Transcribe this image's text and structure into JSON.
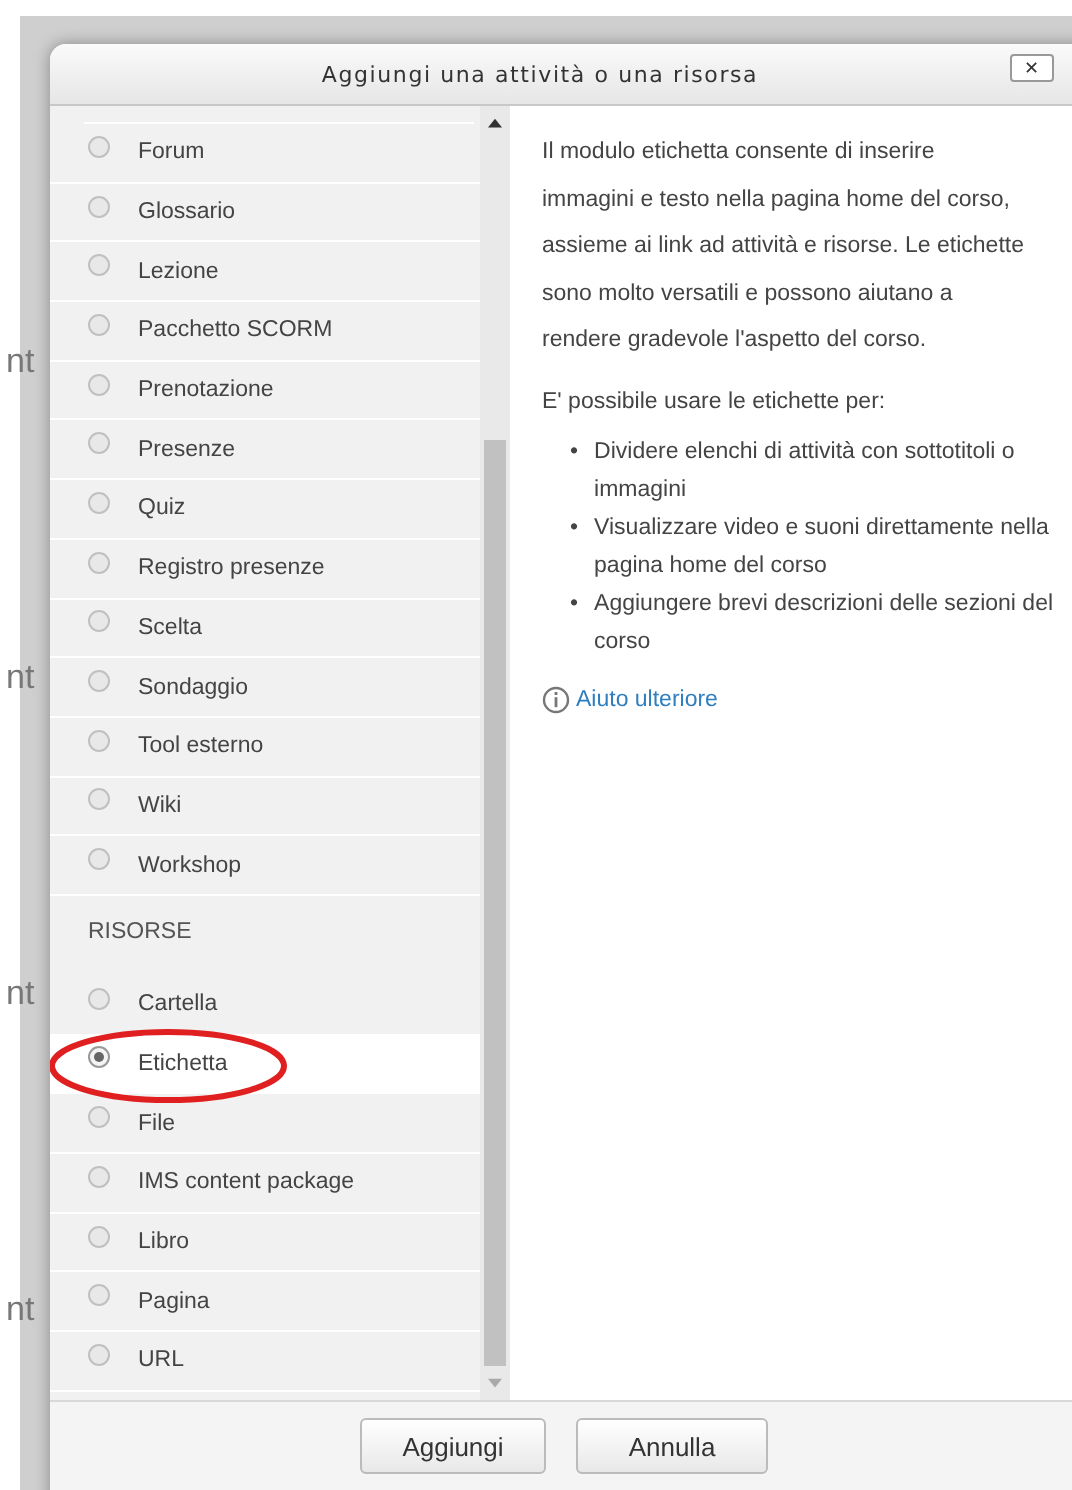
{
  "background": {
    "fragments": [
      "nt",
      "nt",
      "nt",
      "nt"
    ]
  },
  "dialog": {
    "title": "Aggiungi una attività o una risorsa",
    "close": "✕",
    "sections": [
      {
        "items": [
          {
            "label": "Forum",
            "selected": false,
            "circled": false
          },
          {
            "label": "Glossario",
            "selected": false,
            "circled": false
          },
          {
            "label": "Lezione",
            "selected": false,
            "circled": false
          },
          {
            "label": "Pacchetto SCORM",
            "selected": false,
            "circled": false
          },
          {
            "label": "Prenotazione",
            "selected": false,
            "circled": false
          },
          {
            "label": "Presenze",
            "selected": false,
            "circled": false
          },
          {
            "label": "Quiz",
            "selected": false,
            "circled": false
          },
          {
            "label": "Registro presenze",
            "selected": false,
            "circled": false
          },
          {
            "label": "Scelta",
            "selected": false,
            "circled": false
          },
          {
            "label": "Sondaggio",
            "selected": false,
            "circled": false
          },
          {
            "label": "Tool esterno",
            "selected": false,
            "circled": false
          },
          {
            "label": "Wiki",
            "selected": false,
            "circled": false
          },
          {
            "label": "Workshop",
            "selected": false,
            "circled": false
          }
        ]
      },
      {
        "heading": "RISORSE",
        "items": [
          {
            "label": "Cartella",
            "selected": false,
            "circled": false
          },
          {
            "label": "Etichetta",
            "selected": true,
            "circled": true
          },
          {
            "label": "File",
            "selected": false,
            "circled": false
          },
          {
            "label": "IMS content package",
            "selected": false,
            "circled": false
          },
          {
            "label": "Libro",
            "selected": false,
            "circled": false
          },
          {
            "label": "Pagina",
            "selected": false,
            "circled": false
          },
          {
            "label": "URL",
            "selected": false,
            "circled": false
          }
        ]
      }
    ],
    "description": {
      "paragraphs": [
        "Il modulo etichetta consente di inserire immagini e testo nella pagina home del corso, assieme ai link ad attività e risorse. Le etichette sono molto versatili e possono aiutano a rendere gradevole l'aspetto del corso.",
        "E' possibile usare le etichette per:"
      ],
      "bullet_marker": "•",
      "bullets": [
        "Dividere elenchi di attività con sottotitoli o immagini",
        "Visualizzare video e suoni direttamente nella pagina home del corso",
        "Aggiungere brevi descrizioni delle sezioni del corso"
      ],
      "help_link": "Aiuto ulteriore"
    },
    "buttons": [
      "Aggiungi",
      "Annulla"
    ]
  }
}
